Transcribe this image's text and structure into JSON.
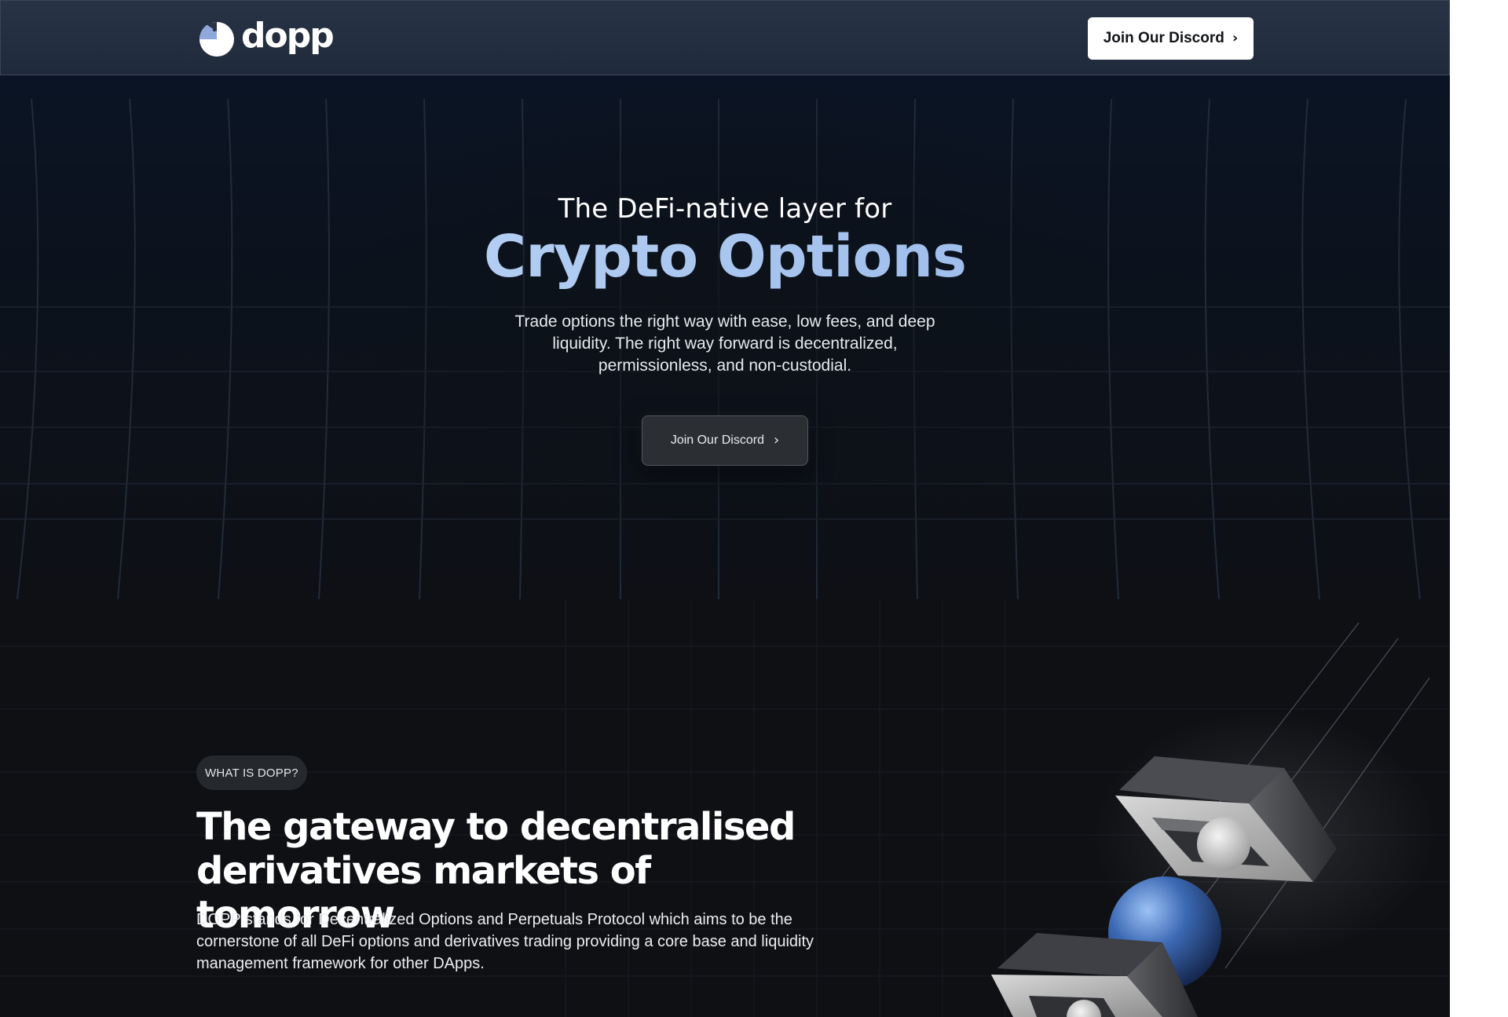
{
  "header": {
    "logo_text": "dopp",
    "logo_icon": "dopp-logo-icon",
    "cta_label": "Join Our Discord",
    "cta_icon": "chevron-right-icon"
  },
  "hero": {
    "kicker": "The DeFi-native layer for",
    "title": "Crypto Options",
    "description": "Trade options the right way with ease, low fees, and deep liquidity. The right way forward is decentralized, permissionless, and non-custodial.",
    "cta_label": "Join Our Discord",
    "cta_icon": "chevron-right-icon"
  },
  "about": {
    "badge": "WHAT IS DOPP?",
    "title": "The gateway to decentralised derivatives markets of tomorrow",
    "description": "DOPP stands for Decentralized Options and Perpetuals Protocol which aims to be the cornerstone of all DeFi options and derivatives trading providing a core base and liquidity management framework for other DApps."
  },
  "colors": {
    "page_bg": "#0e1014",
    "header_bg": "#283345",
    "accent_gradient_start": "#c9ddf7",
    "accent_gradient_end": "#8eaee6",
    "sphere_blue": "#3a66b0"
  }
}
